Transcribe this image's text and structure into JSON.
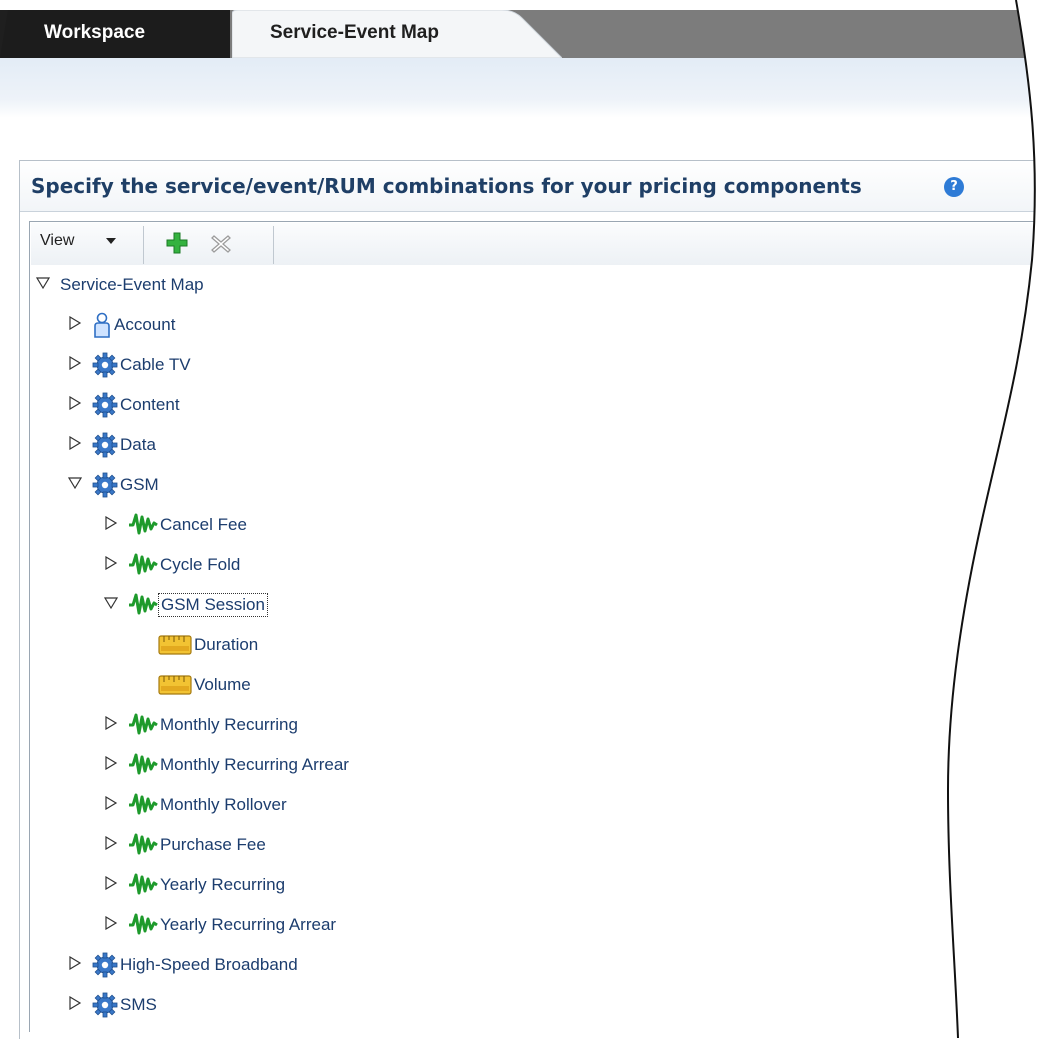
{
  "tabs": {
    "workspace_label": "Workspace",
    "active_label": "Service-Event Map"
  },
  "panel": {
    "title": "Specify the service/event/RUM combinations for your pricing components",
    "help_glyph": "?"
  },
  "toolbar": {
    "view_label": "View",
    "add_icon": "add-icon",
    "delete_icon": "delete-icon"
  },
  "tree": {
    "root": {
      "label": "Service-Event Map",
      "expanded": true
    },
    "items": [
      {
        "label": "Account",
        "icon": "person-icon",
        "expanded": false,
        "level": 1
      },
      {
        "label": "Cable TV",
        "icon": "gear-icon",
        "expanded": false,
        "level": 1
      },
      {
        "label": "Content",
        "icon": "gear-icon",
        "expanded": false,
        "level": 1
      },
      {
        "label": "Data",
        "icon": "gear-icon",
        "expanded": false,
        "level": 1
      },
      {
        "label": "GSM",
        "icon": "gear-icon",
        "expanded": true,
        "level": 1
      },
      {
        "label": "Cancel Fee",
        "icon": "event-icon",
        "expanded": false,
        "level": 2
      },
      {
        "label": "Cycle Fold",
        "icon": "event-icon",
        "expanded": false,
        "level": 2
      },
      {
        "label": "GSM Session",
        "icon": "event-icon",
        "expanded": true,
        "level": 2,
        "focused": true
      },
      {
        "label": "Duration",
        "icon": "ruler-icon",
        "level": 3
      },
      {
        "label": "Volume",
        "icon": "ruler-icon",
        "level": 3
      },
      {
        "label": "Monthly Recurring",
        "icon": "event-icon",
        "expanded": false,
        "level": 2
      },
      {
        "label": "Monthly Recurring Arrear",
        "icon": "event-icon",
        "expanded": false,
        "level": 2
      },
      {
        "label": "Monthly Rollover",
        "icon": "event-icon",
        "expanded": false,
        "level": 2
      },
      {
        "label": "Purchase Fee",
        "icon": "event-icon",
        "expanded": false,
        "level": 2
      },
      {
        "label": "Yearly Recurring",
        "icon": "event-icon",
        "expanded": false,
        "level": 2
      },
      {
        "label": "Yearly Recurring Arrear",
        "icon": "event-icon",
        "expanded": false,
        "level": 2
      },
      {
        "label": "High-Speed Broadband",
        "icon": "gear-icon",
        "expanded": false,
        "level": 1
      },
      {
        "label": "SMS",
        "icon": "gear-icon",
        "expanded": false,
        "level": 1
      }
    ]
  },
  "colors": {
    "tree_text": "#1c3d6e",
    "title_text": "#1f3f66",
    "event_icon": "#1e9a2c",
    "gear_icon": "#3a78c8",
    "add_icon": "#2fae3a"
  }
}
